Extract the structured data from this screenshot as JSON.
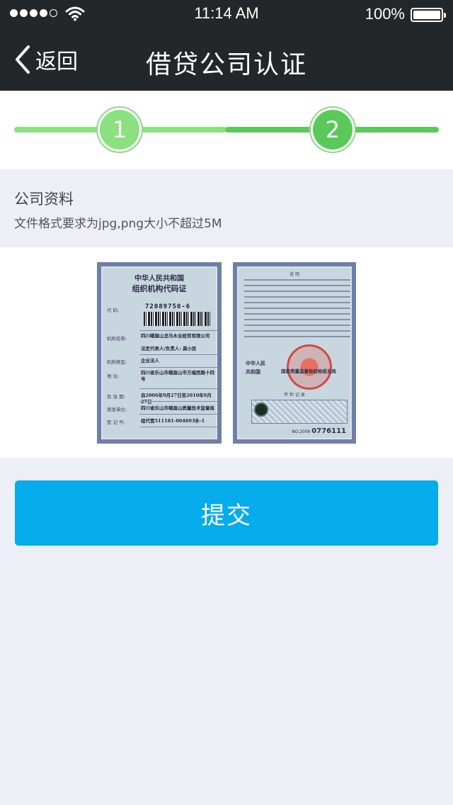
{
  "status_bar": {
    "signal_dots": 5,
    "signal_strength": 4,
    "time": "11:14 AM",
    "battery_percent": "100%",
    "battery_level": 1.0
  },
  "nav": {
    "back_label": "返回",
    "title": "借贷公司认证"
  },
  "steps": {
    "items": [
      {
        "label": "1"
      },
      {
        "label": "2"
      }
    ],
    "current_step": 2,
    "colors": {
      "completed": "#8be07f",
      "active": "#5bc95a"
    }
  },
  "section": {
    "heading": "公司资料",
    "hint": "文件格式要求为jpg,png大小不超过5M"
  },
  "certificate": {
    "front": {
      "title_line1": "中华人民共和国",
      "title_line2": "组织机构代码证",
      "code_label": "代    码:",
      "code": "72089750-6",
      "org_label": "机构名称:",
      "org_value": "四川峨眉山龙马木业经贸有限公司",
      "legal_rep": "法定代表人/负责人: 龚小民",
      "type_label": "机构类型:",
      "type_value": "企业法人",
      "address_label": "地    址:",
      "address_value": "四川省乐山市峨眉山市万福西路十四号",
      "validity_label": "有 效 期:",
      "validity_value": "自2006年9月27日至2010年9月27日",
      "issuer_label": "颁发单位:",
      "issuer_value": "四川省乐山市峨眉山质量技术监督局",
      "reg_label": "登 记 号:",
      "reg_value": "组代管511181-004693补-1"
    },
    "back": {
      "heading": "说        明",
      "label_line1": "中华人民",
      "label_line2": "共和国",
      "authority": "国家质量监督检验检疫总局",
      "annual_label": "年 检 记 录",
      "serial_prefix": "NO.2006",
      "serial": "0776111"
    }
  },
  "submit_label": "提交",
  "colors": {
    "nav_bg": "#232729",
    "page_bg": "#eceff6",
    "primary_button": "#05aceb"
  }
}
